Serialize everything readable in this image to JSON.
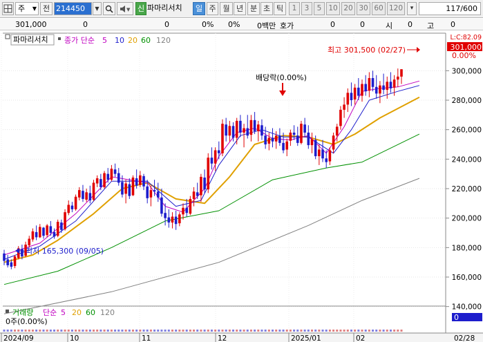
{
  "toolbar": {
    "grid_icon": "grid-icon",
    "market": "주",
    "market_arrow": "▼",
    "view": "전",
    "code": "214450",
    "search_icon": "search-icon",
    "sound_icon": "speaker-icon",
    "new_badge": "신",
    "stock_name": "파마리서치",
    "periods": [
      "일",
      "주",
      "월",
      "년",
      "분",
      "초",
      "틱"
    ],
    "selected_period": "일",
    "minutes": [
      "1",
      "3",
      "5",
      "10",
      "20",
      "30",
      "60",
      "120"
    ],
    "count": "117/600"
  },
  "info": {
    "price": "301,000",
    "v1": "0",
    "v2": "0",
    "p1": "0%",
    "p2": "0%",
    "b1": "0백만",
    "b2": "호가",
    "b3": "0",
    "b4": "0",
    "b5": "시",
    "b6": "0",
    "b7": "고",
    "b8": "0"
  },
  "chart_data": {
    "type": "candlestick",
    "title": "파마리서치",
    "legend": [
      {
        "label": "종가 단순",
        "color": "#c000c0"
      },
      {
        "label": "5",
        "color": "#c000c0"
      },
      {
        "label": "10",
        "color": "#1d1dcc"
      },
      {
        "label": "20",
        "color": "#e0a000"
      },
      {
        "label": "60",
        "color": "#009000"
      },
      {
        "label": "120",
        "color": "#808080"
      }
    ],
    "y_axis": {
      "min": 120000,
      "max": 305000,
      "ticks": [
        "300,000",
        "280,000",
        "260,000",
        "240,000",
        "220,000",
        "200,000",
        "180,000",
        "160,000",
        "140,000"
      ],
      "side": "right"
    },
    "x_axis": {
      "labels": [
        "2024/09",
        "10",
        "11",
        "12",
        "2025/01",
        "02",
        "02/28"
      ]
    },
    "annotations": {
      "high": "최고 301,500 (02/27)",
      "low": "최저 165,300 (09/05)",
      "dividend": "배당락(0.00%)"
    },
    "current": {
      "price": "301,000",
      "pct": "0.00%",
      "flag": "L:C:82.09"
    },
    "ohlc": [
      [
        176000,
        178500,
        168000,
        171000
      ],
      [
        172000,
        175000,
        166500,
        168000
      ],
      [
        170000,
        172000,
        165300,
        167000
      ],
      [
        167500,
        175000,
        166000,
        174000
      ],
      [
        173000,
        181000,
        172000,
        179500
      ],
      [
        179000,
        182000,
        172000,
        174000
      ],
      [
        174500,
        184000,
        173500,
        182000
      ],
      [
        181500,
        188000,
        180000,
        186000
      ],
      [
        185500,
        193000,
        184000,
        191000
      ],
      [
        190500,
        195000,
        185000,
        187000
      ],
      [
        187000,
        196000,
        186500,
        194000
      ],
      [
        193500,
        194000,
        186000,
        188000
      ],
      [
        188500,
        196000,
        187000,
        195000
      ],
      [
        194500,
        198000,
        188000,
        190000
      ],
      [
        190500,
        193000,
        186000,
        187500
      ],
      [
        188000,
        199000,
        187000,
        197500
      ],
      [
        197000,
        199000,
        190000,
        192000
      ],
      [
        192500,
        206000,
        191500,
        204000
      ],
      [
        203500,
        212000,
        202000,
        209000
      ],
      [
        208500,
        211000,
        204000,
        206000
      ],
      [
        206000,
        216000,
        205000,
        214500
      ],
      [
        214000,
        221000,
        212000,
        219000
      ],
      [
        218500,
        222500,
        211000,
        213000
      ],
      [
        212500,
        220000,
        211000,
        217500
      ],
      [
        217000,
        222000,
        210000,
        212000
      ],
      [
        212500,
        226000,
        211500,
        224000
      ],
      [
        223500,
        229000,
        221000,
        227000
      ],
      [
        226500,
        230000,
        219000,
        221000
      ],
      [
        221000,
        232000,
        220000,
        230500
      ],
      [
        230000,
        234000,
        224000,
        226000
      ],
      [
        226000,
        236000,
        225000,
        233500
      ],
      [
        233000,
        237000,
        228000,
        230000
      ],
      [
        230500,
        234000,
        222000,
        224000
      ],
      [
        224500,
        229000,
        214000,
        216000
      ],
      [
        216500,
        226000,
        210000,
        223500
      ],
      [
        223000,
        227000,
        213000,
        215000
      ],
      [
        215500,
        229000,
        215000,
        227500
      ],
      [
        227000,
        233000,
        220000,
        222000
      ],
      [
        222500,
        232000,
        221000,
        229000
      ],
      [
        228500,
        230000,
        219000,
        221500
      ],
      [
        221500,
        226000,
        210000,
        213500
      ],
      [
        214000,
        222000,
        208000,
        219000
      ],
      [
        219000,
        226000,
        215000,
        218000
      ],
      [
        218000,
        224000,
        211000,
        214000
      ],
      [
        214000,
        220000,
        201000,
        203000
      ],
      [
        203500,
        210000,
        195000,
        200000
      ],
      [
        200500,
        206000,
        193500,
        197000
      ],
      [
        197000,
        204000,
        193000,
        201000
      ],
      [
        201000,
        205000,
        192000,
        196000
      ],
      [
        196500,
        204000,
        194500,
        202500
      ],
      [
        202500,
        210000,
        199000,
        207000
      ],
      [
        207000,
        213000,
        201000,
        203500
      ],
      [
        203000,
        215000,
        202000,
        213000
      ],
      [
        213000,
        221000,
        208000,
        218000
      ],
      [
        217500,
        224000,
        213000,
        215000
      ],
      [
        215500,
        230000,
        211000,
        228000
      ],
      [
        227500,
        233000,
        217000,
        219500
      ],
      [
        219500,
        244000,
        217000,
        241000
      ],
      [
        241000,
        248000,
        233000,
        237000
      ],
      [
        237000,
        248000,
        232000,
        246000
      ],
      [
        246000,
        252000,
        240000,
        244000
      ],
      [
        244000,
        267000,
        242000,
        264000
      ],
      [
        263500,
        268000,
        252000,
        256000
      ],
      [
        256000,
        266000,
        252000,
        262500
      ],
      [
        262500,
        265000,
        252000,
        254500
      ],
      [
        254500,
        268000,
        250000,
        266000
      ],
      [
        266000,
        270000,
        255000,
        258000
      ],
      [
        258000,
        264000,
        248000,
        261000
      ],
      [
        261000,
        270000,
        254000,
        256000
      ],
      [
        256500,
        270000,
        252000,
        266500
      ],
      [
        266500,
        272000,
        257000,
        259000
      ],
      [
        259000,
        266000,
        252000,
        263500
      ],
      [
        263000,
        267000,
        253000,
        256000
      ],
      [
        256000,
        262000,
        247000,
        250000
      ],
      [
        250500,
        258000,
        246000,
        254500
      ],
      [
        254500,
        261000,
        248000,
        252000
      ],
      [
        252000,
        259000,
        247000,
        256000
      ],
      [
        256000,
        261000,
        249000,
        251000
      ],
      [
        251000,
        258000,
        244000,
        246000
      ],
      [
        246500,
        254000,
        242000,
        252000
      ],
      [
        252500,
        260000,
        249000,
        258000
      ],
      [
        258000,
        263000,
        253000,
        256500
      ],
      [
        256000,
        262000,
        249000,
        251000
      ],
      [
        251000,
        266000,
        250000,
        264000
      ],
      [
        263500,
        268000,
        255000,
        258000
      ],
      [
        258000,
        263000,
        247000,
        249500
      ],
      [
        249500,
        258000,
        244000,
        253500
      ],
      [
        253000,
        256000,
        240000,
        242000
      ],
      [
        242000,
        250000,
        236000,
        246500
      ],
      [
        246500,
        253000,
        238000,
        240500
      ],
      [
        240500,
        246000,
        234000,
        238000
      ],
      [
        238500,
        248000,
        236000,
        246000
      ],
      [
        246500,
        258000,
        244000,
        256000
      ],
      [
        256000,
        264000,
        252000,
        262000
      ],
      [
        262500,
        276000,
        260000,
        273500
      ],
      [
        273500,
        282000,
        268000,
        277000
      ],
      [
        277000,
        288000,
        272000,
        285000
      ],
      [
        285000,
        292000,
        276000,
        280000
      ],
      [
        280500,
        291000,
        277000,
        288500
      ],
      [
        288500,
        295000,
        280000,
        283000
      ],
      [
        283000,
        294000,
        279000,
        291000
      ],
      [
        291000,
        297000,
        283000,
        286000
      ],
      [
        286500,
        299000,
        282000,
        295000
      ],
      [
        295000,
        300000,
        286000,
        289000
      ],
      [
        289000,
        297000,
        281000,
        284500
      ],
      [
        284500,
        293000,
        278000,
        290000
      ],
      [
        290000,
        298000,
        284000,
        287000
      ],
      [
        287000,
        296000,
        281000,
        292500
      ],
      [
        292500,
        299000,
        285000,
        288000
      ],
      [
        288500,
        297000,
        283000,
        294000
      ],
      [
        294000,
        301500,
        289000,
        296000
      ],
      [
        296000,
        301000,
        291000,
        301000
      ]
    ],
    "ma5": [
      [
        0,
        175000
      ],
      [
        10,
        183000
      ],
      [
        20,
        203000
      ],
      [
        30,
        228000
      ],
      [
        40,
        224000
      ],
      [
        45,
        208000
      ],
      [
        50,
        204000
      ],
      [
        56,
        220000
      ],
      [
        60,
        242000
      ],
      [
        65,
        258000
      ],
      [
        70,
        261000
      ],
      [
        75,
        254000
      ],
      [
        80,
        253000
      ],
      [
        85,
        256000
      ],
      [
        90,
        244000
      ],
      [
        95,
        262000
      ],
      [
        100,
        286000
      ],
      [
        105,
        288000
      ],
      [
        110,
        289000
      ],
      [
        116,
        293000
      ]
    ],
    "ma10": [
      [
        0,
        172000
      ],
      [
        10,
        181000
      ],
      [
        20,
        198000
      ],
      [
        30,
        225000
      ],
      [
        40,
        225000
      ],
      [
        48,
        208000
      ],
      [
        55,
        212000
      ],
      [
        60,
        236000
      ],
      [
        66,
        256000
      ],
      [
        72,
        260000
      ],
      [
        78,
        255000
      ],
      [
        85,
        255000
      ],
      [
        92,
        244000
      ],
      [
        97,
        260000
      ],
      [
        102,
        280000
      ],
      [
        110,
        286000
      ],
      [
        116,
        290000
      ]
    ],
    "ma20": [
      [
        0,
        170000
      ],
      [
        8,
        175000
      ],
      [
        15,
        185000
      ],
      [
        25,
        203000
      ],
      [
        33,
        220000
      ],
      [
        40,
        224000
      ],
      [
        48,
        213000
      ],
      [
        56,
        210000
      ],
      [
        63,
        228000
      ],
      [
        70,
        250000
      ],
      [
        78,
        256000
      ],
      [
        85,
        255000
      ],
      [
        92,
        250000
      ],
      [
        98,
        257000
      ],
      [
        105,
        268000
      ],
      [
        116,
        282000
      ]
    ],
    "ma60": [
      [
        0,
        155000
      ],
      [
        15,
        164000
      ],
      [
        30,
        180000
      ],
      [
        45,
        198000
      ],
      [
        60,
        205000
      ],
      [
        75,
        226000
      ],
      [
        90,
        234000
      ],
      [
        100,
        238000
      ],
      [
        116,
        257000
      ]
    ],
    "ma120": [
      [
        0,
        135000
      ],
      [
        30,
        150000
      ],
      [
        60,
        170000
      ],
      [
        85,
        195000
      ],
      [
        100,
        212000
      ],
      [
        116,
        227000
      ]
    ],
    "volume": {
      "legend": [
        "거래량",
        "단순",
        "5",
        "20",
        "60",
        "120"
      ],
      "value": "0주(0.00%)",
      "right_value": "0"
    }
  }
}
